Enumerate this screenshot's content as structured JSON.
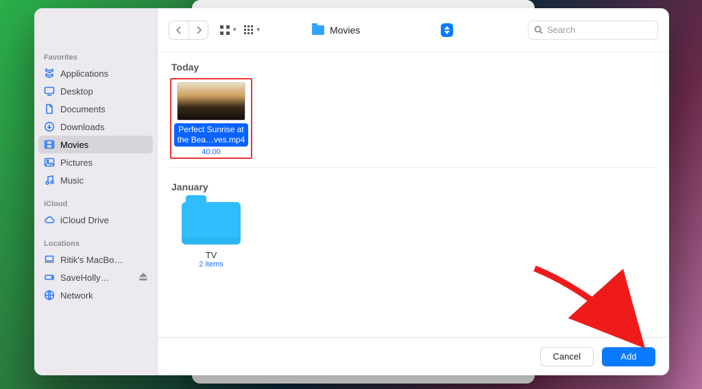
{
  "sidebar": {
    "sections": {
      "favorites": {
        "title": "Favorites",
        "items": [
          {
            "label": "Applications",
            "icon": "apps"
          },
          {
            "label": "Desktop",
            "icon": "desktop"
          },
          {
            "label": "Documents",
            "icon": "doc"
          },
          {
            "label": "Downloads",
            "icon": "download"
          },
          {
            "label": "Movies",
            "icon": "movie"
          },
          {
            "label": "Pictures",
            "icon": "picture"
          },
          {
            "label": "Music",
            "icon": "music"
          }
        ],
        "selected_label": "Movies"
      },
      "icloud": {
        "title": "iCloud",
        "items": [
          {
            "label": "iCloud Drive",
            "icon": "cloud"
          }
        ]
      },
      "locations": {
        "title": "Locations",
        "items": [
          {
            "label": "Ritik's MacBo…",
            "icon": "laptop"
          },
          {
            "label": "SaveHolly…",
            "icon": "disk",
            "eject": true
          },
          {
            "label": "Network",
            "icon": "globe"
          }
        ]
      }
    }
  },
  "toolbar": {
    "path_label": "Movies",
    "search_placeholder": "Search"
  },
  "groups": [
    {
      "title": "Today",
      "items": [
        {
          "kind": "file",
          "name": "Perfect Sunrise at the Bea…ves.mp4",
          "meta": "40:00",
          "selected": true,
          "annotated": true
        }
      ]
    },
    {
      "title": "January",
      "items": [
        {
          "kind": "folder",
          "name": "TV",
          "meta": "2 items"
        }
      ]
    }
  ],
  "footer": {
    "cancel_label": "Cancel",
    "primary_label": "Add"
  }
}
